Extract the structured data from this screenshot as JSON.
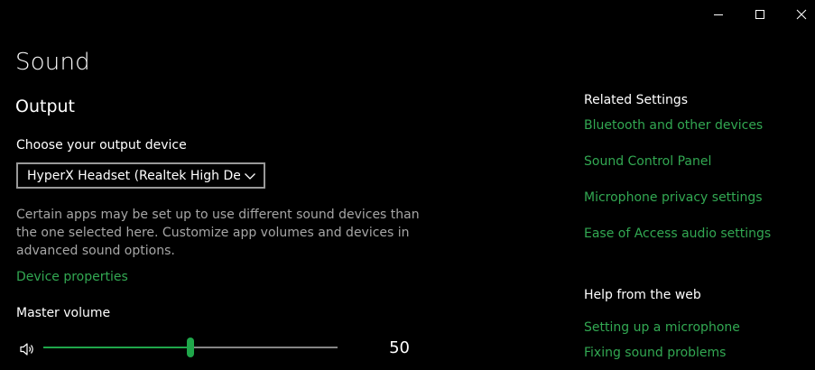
{
  "window": {
    "controls": {
      "minimize_icon": "minimize-icon",
      "maximize_icon": "maximize-icon",
      "close_icon": "close-icon"
    }
  },
  "page": {
    "title": "Sound"
  },
  "output": {
    "section_title": "Output",
    "choose_label": "Choose your output device",
    "selected_device": "HyperX Headset (Realtek High De...",
    "description": "Certain apps may be set up to use different sound devices than the one selected here. Customize app volumes and devices in advanced sound options.",
    "device_properties_link": "Device properties",
    "master_volume_label": "Master volume",
    "volume_value": "50",
    "volume_level": 0.5
  },
  "related_settings": {
    "heading": "Related Settings",
    "links": [
      "Bluetooth and other devices",
      "Sound Control Panel",
      "Microphone privacy settings",
      "Ease of Access audio settings"
    ]
  },
  "help": {
    "heading": "Help from the web",
    "links": [
      "Setting up a microphone",
      "Fixing sound problems"
    ]
  },
  "colors": {
    "background": "#000000",
    "accent": "#32a852",
    "text": "#ffffff",
    "secondary_text": "#a6a6a6"
  }
}
